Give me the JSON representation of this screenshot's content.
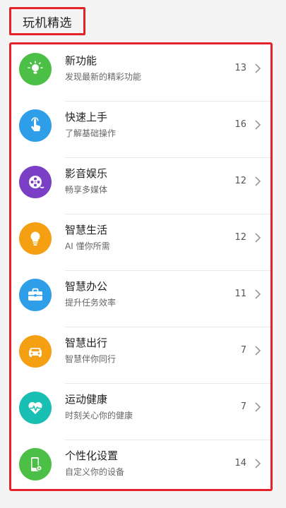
{
  "header": {
    "title": "玩机精选"
  },
  "items": [
    {
      "title": "新功能",
      "subtitle": "发现最新的精彩功能",
      "count": "13",
      "color": "#4cc046",
      "icon": "bulb-icon"
    },
    {
      "title": "快速上手",
      "subtitle": "了解基础操作",
      "count": "16",
      "color": "#2f9ee8",
      "icon": "tap-hand-icon"
    },
    {
      "title": "影音娱乐",
      "subtitle": "畅享多媒体",
      "count": "12",
      "color": "#7a3fc4",
      "icon": "film-reel-icon"
    },
    {
      "title": "智慧生活",
      "subtitle": "AI 懂你所需",
      "count": "12",
      "color": "#f5a012",
      "icon": "lightbulb-icon"
    },
    {
      "title": "智慧办公",
      "subtitle": "提升任务效率",
      "count": "11",
      "color": "#2f9ee8",
      "icon": "briefcase-icon"
    },
    {
      "title": "智慧出行",
      "subtitle": "智慧伴你同行",
      "count": "7",
      "color": "#f5a012",
      "icon": "car-icon"
    },
    {
      "title": "运动健康",
      "subtitle": "时刻关心你的健康",
      "count": "7",
      "color": "#19bfb3",
      "icon": "heart-pulse-icon"
    },
    {
      "title": "个性化设置",
      "subtitle": "自定义你的设备",
      "count": "14",
      "color": "#4cc046",
      "icon": "phone-settings-icon"
    }
  ]
}
